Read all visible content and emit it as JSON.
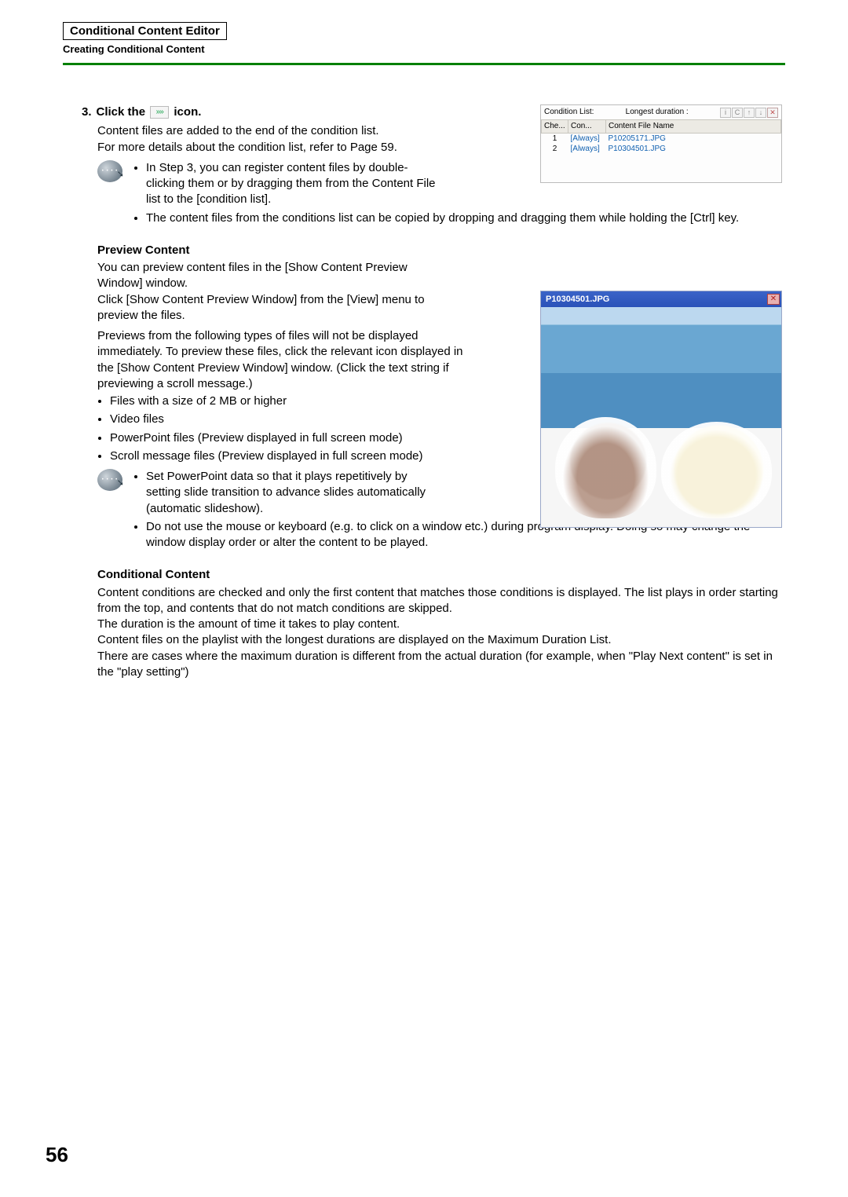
{
  "header": {
    "box_title": "Conditional Content Editor",
    "subheader": "Creating Conditional Content"
  },
  "step3": {
    "number": "3.",
    "prefix": "Click the",
    "icon_glyph": "»»",
    "suffix": "icon.",
    "line1": "Content files are added to the end of the condition list.",
    "line2": "For more details about the condition list, refer to Page 59.",
    "tips": {
      "a": "In Step 3, you can register content files by double-clicking them or by dragging them from the Content File list to the [condition list].",
      "b": "The content files from the conditions list can be copied by dropping and dragging them while holding the [Ctrl] key."
    }
  },
  "cond_panel": {
    "label_left": "Condition List:",
    "label_mid": "Longest duration :",
    "cols": {
      "che": "Che...",
      "con": "Con...",
      "name": "Content File Name"
    },
    "rows": [
      {
        "idx": "1",
        "con": "[Always]",
        "name": "P10205171.JPG"
      },
      {
        "idx": "2",
        "con": "[Always]",
        "name": "P10304501.JPG"
      }
    ]
  },
  "preview_section": {
    "title": "Preview Content",
    "p1": "You can preview content files in the [Show Content Preview Window] window.",
    "p2": "Click [Show Content Preview Window] from the [View] menu to preview the files.",
    "p3": "Previews from the following types of files will not be displayed immediately. To preview these files, click the relevant icon displayed in the [Show Content Preview Window] window. (Click the text string if previewing a scroll message.)",
    "bullets": {
      "a": "Files with a size of 2 MB or higher",
      "b": "Video files",
      "c": "PowerPoint files (Preview displayed in full screen mode)",
      "d": "Scroll message files (Preview displayed in full screen mode)"
    },
    "tips": {
      "a": "Set PowerPoint data so that it plays repetitively by setting slide transition to advance slides automatically (automatic slideshow).",
      "b": "Do not use the mouse or keyboard (e.g. to click on a window etc.) during program display. Doing so may change the window display order or alter the content to be played."
    }
  },
  "preview_window": {
    "title": "P10304501.JPG",
    "close_glyph": "✕"
  },
  "conditional_section": {
    "title": "Conditional Content",
    "p1": "Content conditions are checked and only the first content that matches those conditions is displayed. The list plays in order starting from the top, and contents that do not match conditions are skipped.",
    "p2": "The duration is the amount of time it takes to play content.",
    "p3": "Content files on the playlist with the longest durations are displayed on the Maximum Duration List.",
    "p4": "There are cases where the maximum duration is different from the actual duration (for example, when \"Play Next content\" is set in the \"play setting\")"
  },
  "page_number": "56",
  "icons": {
    "info": "i",
    "refresh": "C",
    "up": "↑",
    "down": "↓",
    "delete": "✕"
  }
}
